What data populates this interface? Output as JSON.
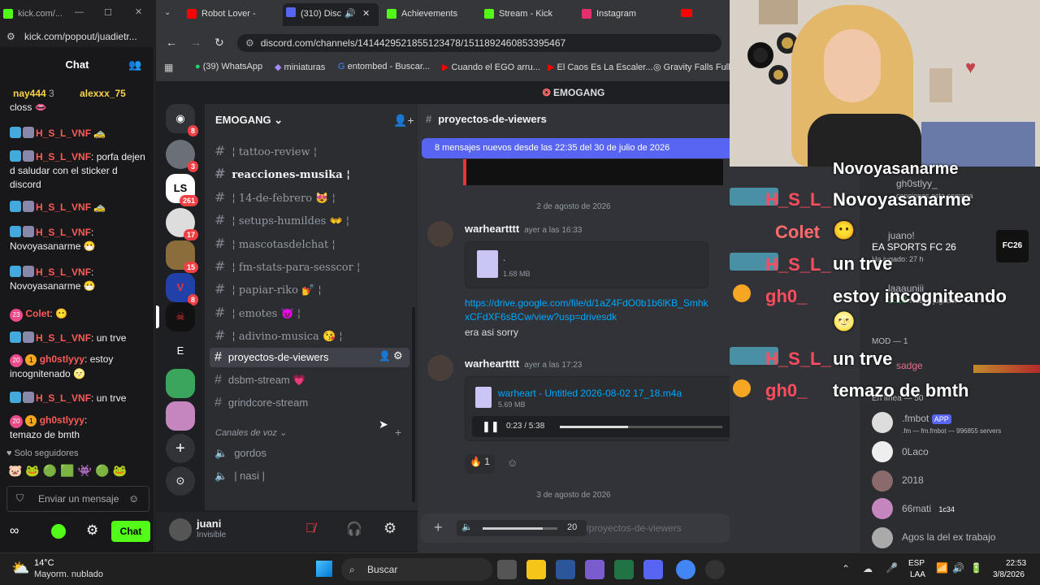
{
  "kick": {
    "tab_title": "kick.com/...",
    "url": "kick.com/popout/juadietr...",
    "header": "Chat",
    "pinned": [
      {
        "user": "nay444",
        "count": "3"
      },
      {
        "user": "alexxx_75"
      }
    ],
    "messages": [
      {
        "user": "",
        "text": "closs"
      },
      {
        "user": "H_S_L_VNF",
        "text": ""
      },
      {
        "user": "H_S_L_VNF",
        "text": ": porfa dejen d saludar con el sticker d discord"
      },
      {
        "user": "H_S_L_VNF",
        "text": ""
      },
      {
        "user": "H_S_L_VNF",
        "text": ":"
      },
      {
        "user": "",
        "text": "Novoyasanarme"
      },
      {
        "user": "H_S_L_VNF",
        "text": ":"
      },
      {
        "user": "",
        "text": "Novoyasanarme"
      },
      {
        "user": "Colet",
        "text": ":",
        "level": "23"
      },
      {
        "user": "H_S_L_VNF",
        "text": ": un trve"
      },
      {
        "user": "gh0stlyyy",
        "text": ": estoy incognitenado",
        "level": "20",
        "rank": "1"
      },
      {
        "user": "H_S_L_VNF",
        "text": ": un trve"
      },
      {
        "user": "gh0stlyyy",
        "text": ":",
        "level": "20",
        "rank": "1"
      },
      {
        "user": "",
        "text": "temazo de bmth"
      }
    ],
    "followers_only": "Solo seguidores",
    "input_placeholder": "Enviar un mensaje",
    "send_label": "Chat"
  },
  "chrome": {
    "tabs": [
      {
        "title": "Robot Lover -",
        "color": "#ff0000"
      },
      {
        "title": "(310) Disc",
        "color": "#5865f2",
        "active": true
      },
      {
        "title": "Achievements",
        "color": "#53fc18"
      },
      {
        "title": "Stream - Kick",
        "color": "#53fc18"
      },
      {
        "title": "Instagram",
        "color": "#e1306c"
      }
    ],
    "url": "discord.com/channels/1414429521855123478/1511892460853395467",
    "bookmarks": [
      "(39) WhatsApp",
      "miniaturas",
      "entombed - Buscar...",
      "Cuando el EGO arru...",
      "El Caos Es La Escaler...",
      "Gravity Falls Full E"
    ]
  },
  "discord": {
    "server_title": "EMOGANG",
    "server_name": "EMOGANG",
    "guild_badges": [
      "8",
      "3",
      "261",
      "17",
      "15",
      "8"
    ],
    "guild_letter": "E",
    "channels": [
      {
        "name": "tattoo-review",
        "unread": false,
        "serif": true
      },
      {
        "name": "reacciones-musika",
        "unread": true,
        "serif": true
      },
      {
        "name": "14-de-febrero",
        "unread": false,
        "serif": true
      },
      {
        "name": "setups-humildes",
        "unread": false,
        "serif": true
      },
      {
        "name": "mascotasdelchat",
        "unread": false,
        "serif": true
      },
      {
        "name": "fm-stats-para-sesscor",
        "unread": false,
        "serif": true
      },
      {
        "name": "papiar-riko",
        "unread": false,
        "serif": true
      },
      {
        "name": "emotes",
        "unread": false,
        "serif": true
      },
      {
        "name": "adivino-musica",
        "unread": false,
        "serif": true
      },
      {
        "name": "proyectos-de-viewers",
        "unread": false,
        "selected": true
      },
      {
        "name": "dsbm-stream",
        "unread": false
      },
      {
        "name": "grindcore-stream",
        "unread": false
      }
    ],
    "voice_category": "Canales de voz",
    "voice_channels": [
      "gordos",
      "| nasi |"
    ],
    "user": {
      "name": "juani",
      "status": "Invisible"
    },
    "channel_title": "proyectos-de-viewers",
    "new_messages_banner": "8 mensajes nuevos desde las 22:35 del 30 de julio de 2026",
    "date_divider_1": "2 de agosto de 2026",
    "date_divider_2": "3 de agosto de 2026",
    "messages": [
      {
        "author": "warheartttt",
        "time": "ayer a las 16:33",
        "file_name": ".",
        "file_size": "1.68 MB",
        "link": "https://drive.google.com/file/d/1aZ4FdO0b1b6lKB_SmhkxCFdXF6sBCw/view?usp=drivesdk",
        "text": "era asi sorry"
      },
      {
        "author": "warheartttt",
        "time": "ayer a las 17:23",
        "file_name": "warheart - Untitled 2026-08-02 17_18.m4a",
        "file_size": "5.69 MB",
        "audio_time": "0:23 / 5:38",
        "audio_progress": 0.42,
        "reaction_count": "1"
      }
    ],
    "composer_placeholder": "#proyectos-de-viewers",
    "volume_value": "20"
  },
  "overlay": {
    "names": [
      {
        "text": "H_S_L_",
        "color": "#ff4d5e"
      },
      {
        "text": "Colet",
        "color": "#ff6b6b"
      },
      {
        "text": "H_S_L_",
        "color": "#ff4d5e"
      },
      {
        "text": "gh0_",
        "color": "#ff4d5e"
      },
      {
        "text": "H_S_L_",
        "color": "#ff4d5e"
      },
      {
        "text": "gh0_",
        "color": "#ff4d5e"
      }
    ],
    "lines": [
      "Novoyasanarme",
      "Novoyasanarme",
      "",
      "un trve",
      "estoy incogniteando",
      "un trve",
      "temazo de bmth"
    ],
    "members": [
      {
        "name": "gh0stlyy_",
        "sub": "canciones esta semana"
      },
      {
        "name": "juano!",
        "sub": "EA SPORTS FC 26",
        "sub2": "Ha jugado: 27 h"
      },
      {
        "name": "laaauniii",
        "sub": "3:23",
        "sub2": "Nuevo jugador"
      },
      {
        "name": "MOD — 1"
      },
      {
        "name": "sadge"
      },
      {
        "name": "En línea — 50"
      },
      {
        "name": ".fmbot",
        "tag": "APP",
        "sub": ".fm — fm.fmbot — 996855 servers"
      },
      {
        "name": "0Laco"
      },
      {
        "name": "2018"
      },
      {
        "name": "66mati",
        "tag": "1c34"
      },
      {
        "name": "Agos la del ex trabajo"
      }
    ],
    "fc_label": "FC26"
  },
  "taskbar": {
    "weather_temp": "14°C",
    "weather_desc": "Mayorm. nublado",
    "search": "Buscar",
    "lang": "ESP",
    "lang2": "LAA",
    "time": "22:53",
    "date": "3/8/2026"
  }
}
